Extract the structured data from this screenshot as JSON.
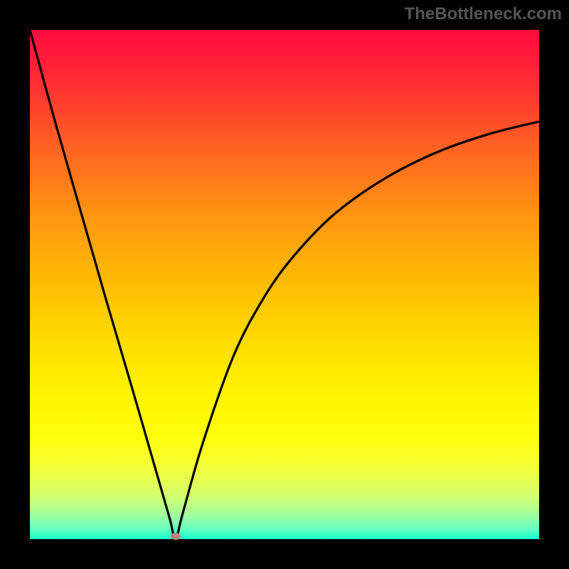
{
  "watermark_text": "TheBottleneck.com",
  "chart_data": {
    "type": "line",
    "title": "",
    "xlabel": "",
    "ylabel": "",
    "xlim": [
      0,
      1
    ],
    "ylim": [
      0,
      1
    ],
    "x_min_is_centered_at": 0.286,
    "series": [
      {
        "name": "curve",
        "note": "V-shaped curve with minimum near x≈0.286 at y≈0 (highlighted by dot). Left branch near-linear rising to y≈1 at x=0; right branch concave approaching y≈0.82 at x=1. Values are relative to plot area (0–1).",
        "x": [
          0.0,
          0.05,
          0.1,
          0.15,
          0.2,
          0.25,
          0.275,
          0.286,
          0.3,
          0.34,
          0.4,
          0.46,
          0.52,
          0.6,
          0.7,
          0.8,
          0.9,
          1.0
        ],
        "y": [
          1.0,
          0.818,
          0.643,
          0.469,
          0.299,
          0.126,
          0.039,
          0.0,
          0.05,
          0.19,
          0.36,
          0.475,
          0.558,
          0.64,
          0.71,
          0.76,
          0.795,
          0.82
        ]
      }
    ],
    "marker": {
      "x": 0.286,
      "y": 0.005,
      "color": "#c08080"
    },
    "background_gradient": {
      "direction": "top-to-bottom",
      "stops": [
        {
          "pos": 0.0,
          "color": "#ff0b3e"
        },
        {
          "pos": 0.25,
          "color": "#ff6a20"
        },
        {
          "pos": 0.5,
          "color": "#ffc304"
        },
        {
          "pos": 0.75,
          "color": "#fdff14"
        },
        {
          "pos": 0.92,
          "color": "#cdff74"
        },
        {
          "pos": 1.0,
          "color": "#16ffcf"
        }
      ]
    }
  }
}
